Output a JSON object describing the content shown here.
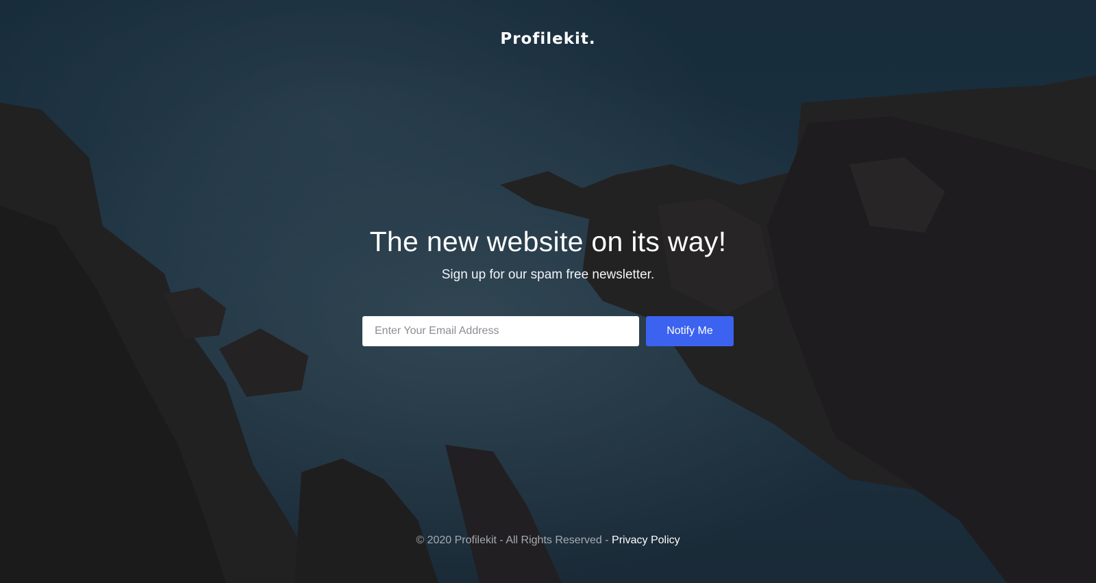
{
  "brand": {
    "logo_text": "Profilekit."
  },
  "hero": {
    "headline": "The new website on its way!",
    "subheadline": "Sign up for our spam free newsletter."
  },
  "signup_form": {
    "email_placeholder": "Enter Your Email Address",
    "email_value": "",
    "submit_label": "Notify Me"
  },
  "footer": {
    "copyright": "© 2020 Profilekit - All Rights Reserved - ",
    "privacy_link": "Privacy Policy"
  },
  "colors": {
    "accent": "#3b63f0",
    "text": "#ffffff"
  }
}
